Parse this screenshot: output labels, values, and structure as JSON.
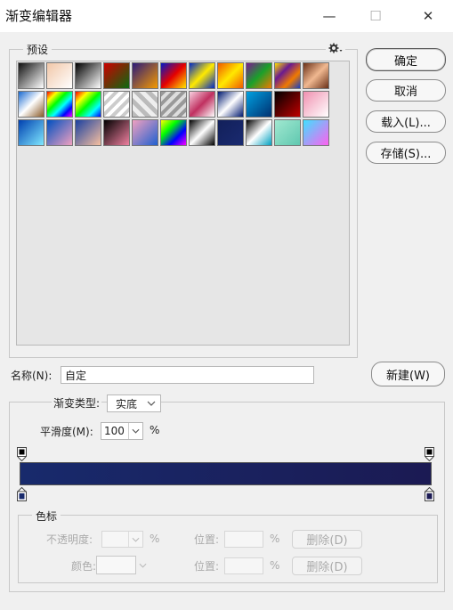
{
  "window": {
    "title": "渐变编辑器",
    "minimize": "—",
    "maximize": "☐",
    "close": "✕"
  },
  "presets": {
    "label": "预设",
    "menu_icon": "gear-icon",
    "swatches": [
      {
        "name": "foreground-to-background",
        "bg": "linear-gradient(135deg,#111,#fff)"
      },
      {
        "name": "foreground-to-transparent",
        "bg": "linear-gradient(135deg,#f1c7a8,#fff)"
      },
      {
        "name": "black-white",
        "bg": "linear-gradient(135deg,#000,#fff)"
      },
      {
        "name": "red-green",
        "bg": "linear-gradient(135deg,#c00,#0a6a10)"
      },
      {
        "name": "violet-orange",
        "bg": "linear-gradient(135deg,#2b1a7a,#f59a00)"
      },
      {
        "name": "blue-red-yellow",
        "bg": "linear-gradient(135deg,#0019c8,#e40000,#ffe800)"
      },
      {
        "name": "blue-yellow-blue",
        "bg": "linear-gradient(135deg,#0028c8,#ffea00,#0028c8)"
      },
      {
        "name": "orange-yellow-orange",
        "bg": "linear-gradient(135deg,#f05a00,#ffe800,#f05a00)"
      },
      {
        "name": "violet-green-orange",
        "bg": "linear-gradient(135deg,#7a1a90,#1aa02a,#f07a00)"
      },
      {
        "name": "yellow-violet-orange-blue",
        "bg": "linear-gradient(135deg,#ffe000,#6a1a90,#f07a00,#1a40c0)"
      },
      {
        "name": "copper",
        "bg": "linear-gradient(135deg,#6a3018,#f0b890,#6a3018)"
      },
      {
        "name": "chrome",
        "bg": "linear-gradient(135deg,#1a6ad0,#fff,#8a5a28)"
      },
      {
        "name": "spectrum",
        "bg": "linear-gradient(135deg,#f00,#ff0,#0f0,#0ff,#00f,#f0f)"
      },
      {
        "name": "transparent-rainbow",
        "bg": "linear-gradient(135deg,#f00,#ff0,#0f0,#0ff,#00f)"
      },
      {
        "name": "transparent-stripes",
        "bg": "repeating-linear-gradient(135deg,#ccc 0 4px,#fff 4px 8px)"
      },
      {
        "name": "transparent-checker",
        "bg": "repeating-linear-gradient(45deg,#bbb 0 5px,#eee 5px 10px)"
      },
      {
        "name": "silver-stripes",
        "bg": "repeating-linear-gradient(135deg,#999 0 4px,#ddd 4px 8px)"
      },
      {
        "name": "pink-stripes",
        "bg": "linear-gradient(135deg,#f8d0e0,#c03060,#fff)"
      },
      {
        "name": "blue-white",
        "bg": "linear-gradient(135deg,#001a70,#fff,#001a70)"
      },
      {
        "name": "cyan-blue",
        "bg": "linear-gradient(135deg,#00a0e0,#003070)"
      },
      {
        "name": "black-red",
        "bg": "linear-gradient(135deg,#000,#c00000)"
      },
      {
        "name": "pink-white",
        "bg": "linear-gradient(135deg,#f090b0,#fff)"
      },
      {
        "name": "blue-cyan",
        "bg": "linear-gradient(135deg,#0040b0,#80e8ff)"
      },
      {
        "name": "blue-pink",
        "bg": "linear-gradient(135deg,#0050c0,#f0a0c0)"
      },
      {
        "name": "blue-peach",
        "bg": "linear-gradient(135deg,#1a40a0,#f8c0a0)"
      },
      {
        "name": "black-pink",
        "bg": "linear-gradient(135deg,#000,#f080a0)"
      },
      {
        "name": "pink-blue",
        "bg": "linear-gradient(135deg,#f0a0c0,#2060d0)"
      },
      {
        "name": "rainbow",
        "bg": "linear-gradient(135deg,#ff0,#0f0,#00f,#f0f)"
      },
      {
        "name": "black-white-stripe",
        "bg": "linear-gradient(135deg,#000,#fff,#000)"
      },
      {
        "name": "navy",
        "bg": "linear-gradient(135deg,#12205a,#1a2a70)"
      },
      {
        "name": "black-white-cyan",
        "bg": "linear-gradient(135deg,#000,#fff,#00a0c0)"
      },
      {
        "name": "mint",
        "bg": "linear-gradient(135deg,#a0e8d0,#60c8b0)"
      },
      {
        "name": "cyan-magenta",
        "bg": "linear-gradient(135deg,#40e0ff,#ff60f0)"
      }
    ]
  },
  "buttons": {
    "ok": "确定",
    "cancel": "取消",
    "load": "载入(L)...",
    "save": "存储(S)...",
    "new": "新建(W)"
  },
  "name": {
    "label": "名称(N):",
    "value": "自定"
  },
  "gradient_type": {
    "label": "渐变类型:",
    "value": "实底"
  },
  "smoothness": {
    "label": "平滑度(M):",
    "value": "100",
    "unit": "%"
  },
  "gradient": {
    "start_color": "#182a6c",
    "end_color": "#1b1a53"
  },
  "stops": {
    "group_label": "色标",
    "opacity_label": "不透明度:",
    "opacity_value": "",
    "opacity_unit": "%",
    "color_label": "颜色:",
    "location_label": "位置:",
    "location_unit": "%",
    "delete_label": "删除(D)"
  }
}
